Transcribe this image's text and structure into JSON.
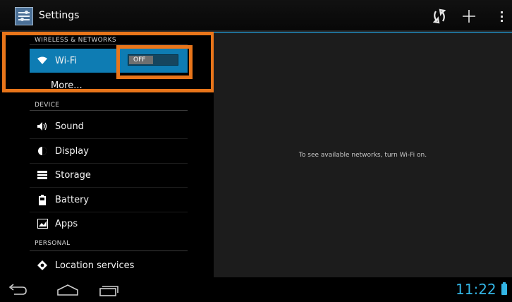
{
  "actionbar": {
    "title": "Settings",
    "refresh_icon": "refresh-icon",
    "add_icon": "add-icon",
    "overflow_icon": "overflow-menu-icon"
  },
  "categories": {
    "wireless": "WIRELESS & NETWORKS",
    "device": "DEVICE",
    "personal": "PERSONAL"
  },
  "items": {
    "wifi": "Wi-Fi",
    "more": "More...",
    "sound": "Sound",
    "display": "Display",
    "storage": "Storage",
    "battery": "Battery",
    "apps": "Apps",
    "location": "Location services"
  },
  "wifi_toggle": {
    "label": "OFF",
    "state": "off"
  },
  "detail": {
    "message": "To see available networks, turn Wi-Fi on."
  },
  "statusbar": {
    "time": "11:22"
  },
  "colors": {
    "accent": "#33b5e5",
    "selected": "#0e7cb3",
    "highlight": "#e8751a"
  }
}
